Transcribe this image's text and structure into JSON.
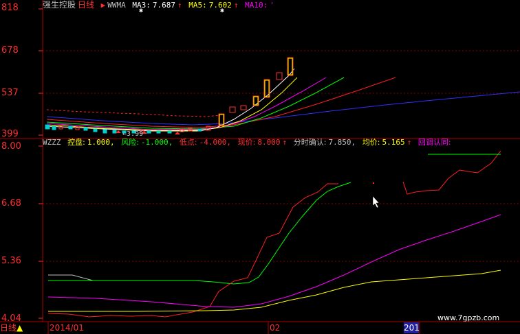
{
  "main_header": {
    "stock_name": "强生控股",
    "period": "日线",
    "indicator": "WWMA",
    "ma3_label": "MA3:",
    "ma3_value": "7.687",
    "ma5_label": "MA5:",
    "ma5_value": "7.602",
    "ma10_label": "MA10:",
    "ma10_value": "'"
  },
  "main_axis": [
    "818",
    "678",
    "537",
    "399"
  ],
  "low_marker": "3.99",
  "sub_header": {
    "name": "WZZZ",
    "kongpan_label": "控盘:",
    "kongpan_value": "1.000,",
    "fengxian_label": "风险:",
    "fengxian_value": "-1.000,",
    "didian_label": "低点:",
    "didian_value": "-4.000,",
    "xianjia_label": "现价:",
    "xianjia_value": "8.000",
    "fenshi_label": "分时确认:",
    "fenshi_value": "7.850,",
    "junjia_label": "均价:",
    "junjia_value": "5.165",
    "huitiao_label": "回调认同:"
  },
  "sub_axis": [
    "8.00",
    "6.68",
    "5.36",
    "4.04"
  ],
  "bottom": {
    "period_tab": "日线",
    "date_start": "2014/01",
    "date_mid": "02",
    "date_end": "201"
  },
  "watermark": "www.7gpzb.com",
  "colors": {
    "axis": "#ff3030",
    "ma3": "#ffffff",
    "ma5": "#ffff00",
    "ma10": "#ff00ff",
    "green": "#00ff00",
    "blue": "#3030ff",
    "red": "#ff2020"
  }
}
